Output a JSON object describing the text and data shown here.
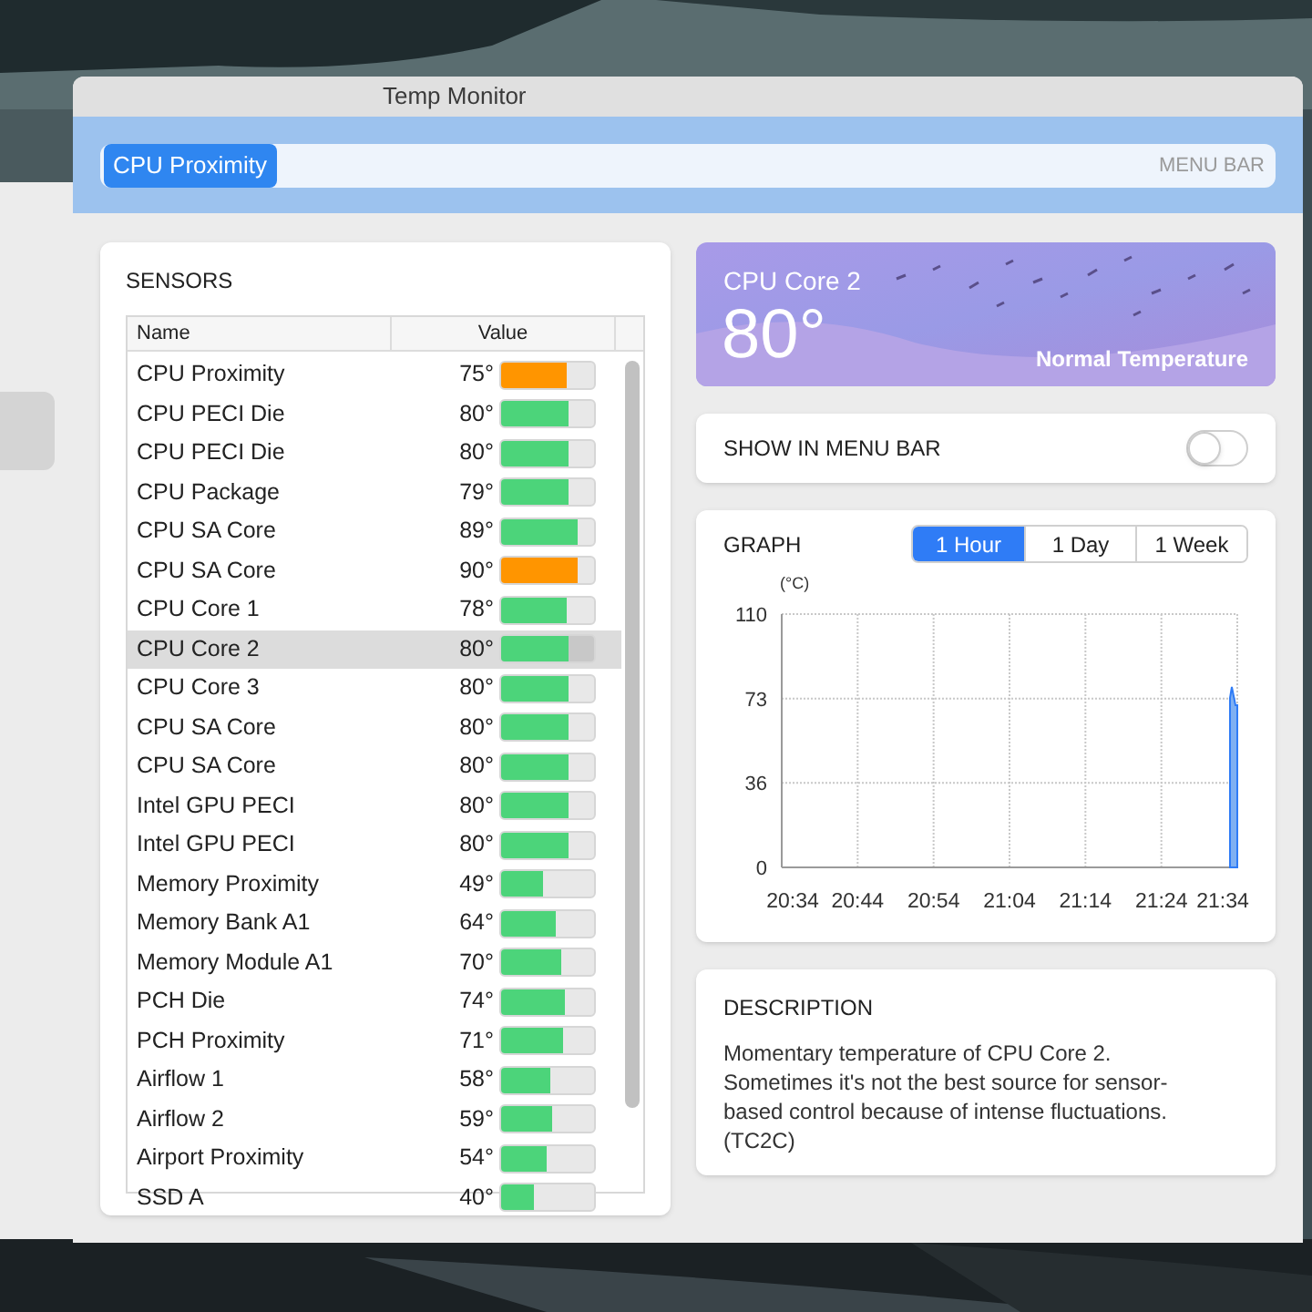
{
  "window": {
    "title": "Temp Monitor"
  },
  "menu_bar_field": {
    "token": "CPU Proximity",
    "label": "MENU BAR"
  },
  "sensors": {
    "title": "SENSORS",
    "columns": [
      "Name",
      "Value"
    ],
    "rows": [
      {
        "name": "CPU Proximity",
        "value": "75°",
        "level": 0.71,
        "color": "#ff9500",
        "selected": false
      },
      {
        "name": "CPU PECI Die",
        "value": "80°",
        "level": 0.73,
        "color": "#4cd47a",
        "selected": false
      },
      {
        "name": "CPU PECI Die",
        "value": "80°",
        "level": 0.73,
        "color": "#4cd47a",
        "selected": false
      },
      {
        "name": "CPU Package",
        "value": "79°",
        "level": 0.73,
        "color": "#4cd47a",
        "selected": false
      },
      {
        "name": "CPU SA Core",
        "value": "89°",
        "level": 0.82,
        "color": "#4cd47a",
        "selected": false
      },
      {
        "name": "CPU SA Core",
        "value": "90°",
        "level": 0.82,
        "color": "#ff9500",
        "selected": false
      },
      {
        "name": "CPU Core 1",
        "value": "78°",
        "level": 0.71,
        "color": "#4cd47a",
        "selected": false
      },
      {
        "name": "CPU Core 2",
        "value": "80°",
        "level": 0.73,
        "color": "#4cd47a",
        "selected": true
      },
      {
        "name": "CPU Core 3",
        "value": "80°",
        "level": 0.73,
        "color": "#4cd47a",
        "selected": false
      },
      {
        "name": "CPU SA Core",
        "value": "80°",
        "level": 0.73,
        "color": "#4cd47a",
        "selected": false
      },
      {
        "name": "CPU SA Core",
        "value": "80°",
        "level": 0.73,
        "color": "#4cd47a",
        "selected": false
      },
      {
        "name": "Intel GPU PECI",
        "value": "80°",
        "level": 0.73,
        "color": "#4cd47a",
        "selected": false
      },
      {
        "name": "Intel GPU PECI",
        "value": "80°",
        "level": 0.73,
        "color": "#4cd47a",
        "selected": false
      },
      {
        "name": "Memory Proximity",
        "value": "49°",
        "level": 0.45,
        "color": "#4cd47a",
        "selected": false
      },
      {
        "name": "Memory Bank A1",
        "value": "64°",
        "level": 0.58,
        "color": "#4cd47a",
        "selected": false
      },
      {
        "name": "Memory Module A1",
        "value": "70°",
        "level": 0.64,
        "color": "#4cd47a",
        "selected": false
      },
      {
        "name": "PCH Die",
        "value": "74°",
        "level": 0.68,
        "color": "#4cd47a",
        "selected": false
      },
      {
        "name": "PCH Proximity",
        "value": "71°",
        "level": 0.66,
        "color": "#4cd47a",
        "selected": false
      },
      {
        "name": "Airflow 1",
        "value": "58°",
        "level": 0.52,
        "color": "#4cd47a",
        "selected": false
      },
      {
        "name": "Airflow 2",
        "value": "59°",
        "level": 0.54,
        "color": "#4cd47a",
        "selected": false
      },
      {
        "name": "Airport Proximity",
        "value": "54°",
        "level": 0.49,
        "color": "#4cd47a",
        "selected": false
      },
      {
        "name": "SSD A",
        "value": "40°",
        "level": 0.36,
        "color": "#4cd47a",
        "selected": false
      }
    ]
  },
  "current": {
    "sensor": "CPU Core 2",
    "value": "80°",
    "status": "Normal Temperature"
  },
  "show_in_menu_bar": {
    "label": "SHOW IN MENU BAR",
    "on": false
  },
  "graph": {
    "title": "GRAPH",
    "ranges": [
      {
        "label": "1 Hour",
        "selected": true
      },
      {
        "label": "1 Day",
        "selected": false
      },
      {
        "label": "1 Week",
        "selected": false
      }
    ],
    "unit": "(°C)",
    "y_ticks": [
      "110",
      "73",
      "36",
      "0"
    ],
    "x_ticks": [
      "20:34",
      "20:44",
      "20:54",
      "21:04",
      "21:14",
      "21:24",
      "21:34"
    ]
  },
  "description": {
    "title": "DESCRIPTION",
    "text": "Momentary temperature of CPU Core 2. Sometimes it's not the best source for sensor-based control because of intense fluctuations. (TC2C)"
  }
}
